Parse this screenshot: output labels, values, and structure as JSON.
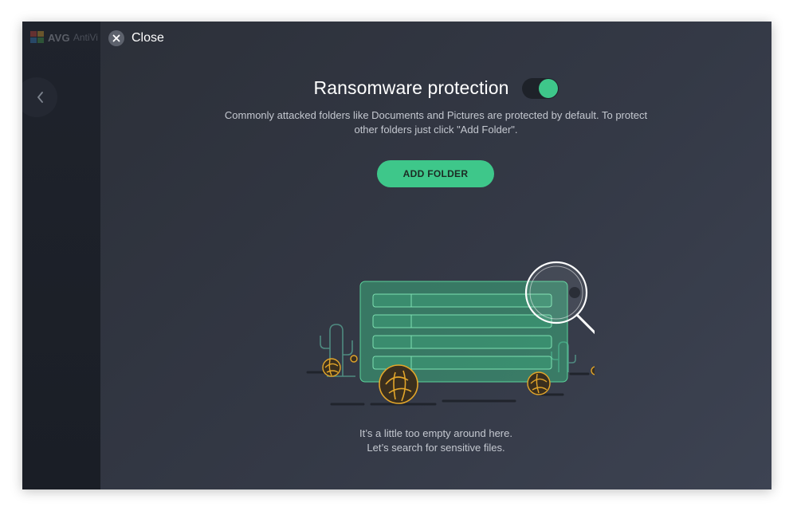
{
  "app": {
    "logo_text": "AVG",
    "product_text": "AntiVi"
  },
  "overlay": {
    "close_label": "Close",
    "title": "Ransomware protection",
    "toggle_on": true,
    "description_line1": "Commonly attacked folders like Documents and Pictures are protected by default. To protect",
    "description_line2": "other folders just click \"Add Folder\".",
    "add_folder_label": "ADD FOLDER",
    "empty_line1": "It’s a little too empty around here.",
    "empty_line2": "Let’s search for sensitive files."
  },
  "icons": {
    "close": "close-icon",
    "back": "chevron-left-icon",
    "illustration": "empty-folder-search-illustration"
  },
  "colors": {
    "accent": "#3ec78a",
    "background": "#2c3039",
    "tumbleweed": "#e3a62a"
  }
}
